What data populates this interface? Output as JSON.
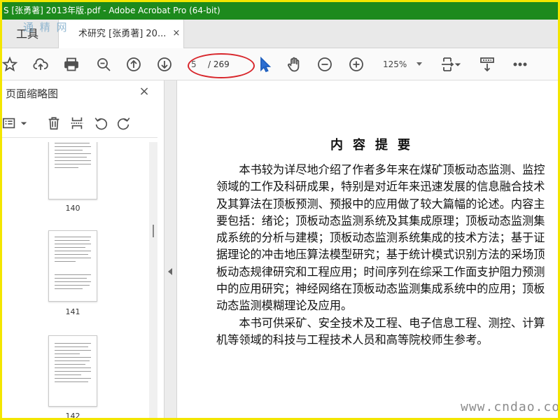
{
  "window": {
    "title": "S [张勇著] 2013年版.pdf - Adobe Acrobat Pro (64-bit)"
  },
  "tabs": {
    "tools_label": "工具",
    "doc_label": "术研究 [张勇著] 20...",
    "close_glyph": "×"
  },
  "watermark_top": "通 精 网",
  "toolbar": {
    "current_page": "5",
    "total_pages": "/ 269",
    "zoom": "125%",
    "icons": [
      "star-icon",
      "cloud-upload-icon",
      "print-icon",
      "zoom-search-icon",
      "page-up-icon",
      "page-down-icon",
      "select-cursor-icon",
      "hand-icon",
      "zoom-out-icon",
      "zoom-in-icon",
      "fit-page-icon",
      "scroll-mode-icon",
      "more-icon"
    ],
    "annotation_color": "#d8262b"
  },
  "sidepanel": {
    "title": "页面缩略图",
    "close_glyph": "×",
    "thumbnails": [
      {
        "label": "140"
      },
      {
        "label": "141"
      },
      {
        "label": "142"
      }
    ]
  },
  "document": {
    "title": "内容提要",
    "paragraphs": [
      "本书较为详尽地介绍了作者多年来在煤矿顶板动态监测、监控领域的工作及科研成果，特别是对近年来迅速发展的信息融合技术及其算法在顶板预测、预报中的应用做了较大篇幅的论述。内容主要包括：绪论；顶板动态监测系统及其集成原理；顶板动态监测集成系统的分析与建模；顶板动态监测系统集成的技术方法；基于证据理论的冲击地压算法模型研究；基于统计模式识别方法的采场顶板动态规律研究和工程应用；时间序列在综采工作面支护阻力预测中的应用研究；神经网络在顶板动态监测集成系统中的应用；顶板动态监测模糊理论及应用。",
      "本书可供采矿、安全技术及工程、电子信息工程、测控、计算机等领域的科技与工程技术人员和高等院校师生参考。"
    ]
  },
  "watermark_bottom": "www.cndao.com",
  "colors": {
    "titlebar": "#1d8a1d",
    "frame": "#f3e600"
  }
}
